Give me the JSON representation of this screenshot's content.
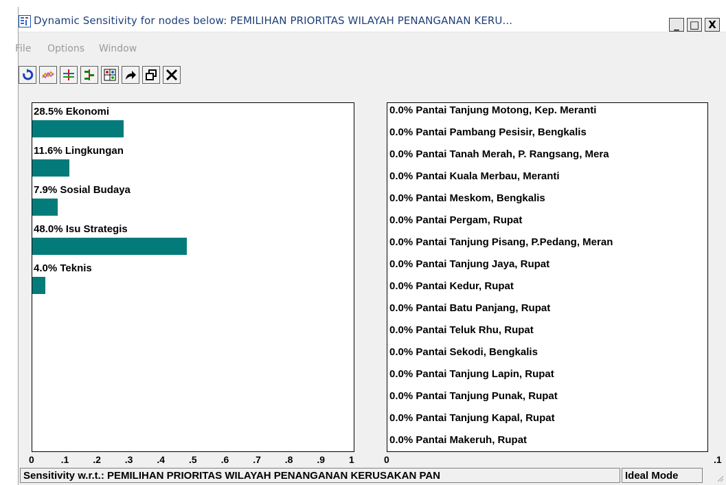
{
  "window": {
    "title": "Dynamic Sensitivity for nodes below: PEMILIHAN PRIORITAS WILAYAH PENANGANAN KERU...",
    "controls": {
      "minimize": "_",
      "maximize": "□",
      "close": "X"
    }
  },
  "menu": [
    {
      "label": "File"
    },
    {
      "label": "Options"
    },
    {
      "label": "Window"
    }
  ],
  "toolbar": [
    {
      "icon": "refresh-icon"
    },
    {
      "icon": "line-graph-icon"
    },
    {
      "icon": "gradient-icon"
    },
    {
      "icon": "head-to-head-icon"
    },
    {
      "icon": "two-d-icon"
    },
    {
      "icon": "redirect-icon"
    },
    {
      "icon": "restore-icon"
    },
    {
      "icon": "close-icon"
    }
  ],
  "criteria_pane": {
    "items": [
      {
        "label": "28.5% Ekonomi",
        "value": 0.285
      },
      {
        "label": "11.6% Lingkungan",
        "value": 0.116
      },
      {
        "label": "7.9% Sosial Budaya",
        "value": 0.079
      },
      {
        "label": "48.0% Isu Strategis",
        "value": 0.48
      },
      {
        "label": "4.0% Teknis",
        "value": 0.04
      }
    ],
    "axis": [
      "0",
      ".1",
      ".2",
      ".3",
      ".4",
      ".5",
      ".6",
      ".7",
      ".8",
      ".9",
      "1"
    ],
    "bar_color": "#047b7b"
  },
  "alternatives_pane": {
    "items": [
      {
        "label": "0.0% Pantai Tanjung Motong, Kep. Meranti"
      },
      {
        "label": "0.0% Pantai Pambang Pesisir, Bengkalis"
      },
      {
        "label": "0.0% Pantai Tanah Merah, P. Rangsang, Mera"
      },
      {
        "label": "0.0% Pantai Kuala Merbau, Meranti"
      },
      {
        "label": "0.0% Pantai Meskom, Bengkalis"
      },
      {
        "label": "0.0% Pantai Pergam, Rupat"
      },
      {
        "label": "0.0% Pantai Tanjung Pisang, P.Pedang, Meran"
      },
      {
        "label": "0.0% Pantai Tanjung Jaya, Rupat"
      },
      {
        "label": "0.0% Pantai Kedur, Rupat"
      },
      {
        "label": "0.0% Pantai Batu Panjang, Rupat"
      },
      {
        "label": "0.0% Pantai Teluk Rhu, Rupat"
      },
      {
        "label": "0.0% Pantai Sekodi, Bengkalis"
      },
      {
        "label": "0.0% Pantai Tanjung Lapin, Rupat"
      },
      {
        "label": "0.0% Pantai Tanjung Punak, Rupat"
      },
      {
        "label": "0.0% Pantai Tanjung Kapal, Rupat"
      },
      {
        "label": "0.0% Pantai Makeruh, Rupat"
      }
    ],
    "axis": [
      "0",
      ".1"
    ]
  },
  "status": {
    "sensitivity": "Sensitivity w.r.t.: PEMILIHAN PRIORITAS WILAYAH PENANGANAN KERUSAKAN PAN",
    "mode": "Ideal Mode"
  }
}
